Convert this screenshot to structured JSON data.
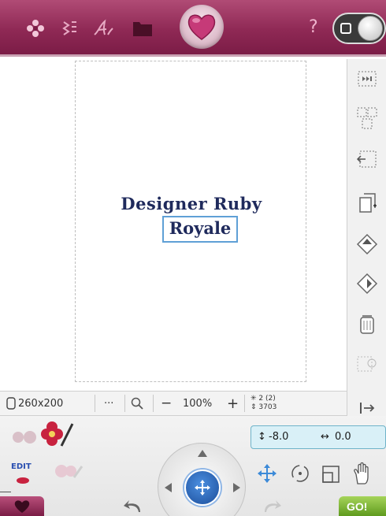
{
  "topbar": {
    "icons": [
      "flower-icon",
      "stitch-icon",
      "font-icon",
      "folder-icon",
      "heart-icon",
      "help-icon",
      "toggle-switch"
    ],
    "help_label": "?"
  },
  "design": {
    "line1": "Designer Ruby",
    "line2": "Royale"
  },
  "status": {
    "hoop_size": "260x200",
    "more": "···",
    "zoom": "100%",
    "zoom_minus": "−",
    "zoom_plus": "+",
    "colors": "2 (2)",
    "stitches": "3703"
  },
  "position": {
    "y": "-8.0",
    "x": "0.0"
  },
  "bottom": {
    "edit_label": "EDIT",
    "go_label": "GO!"
  },
  "colors": {
    "accent": "#8f2955",
    "text": "#1f2a5c",
    "selection": "#5fa0d6",
    "go": "#5f9b1e"
  }
}
